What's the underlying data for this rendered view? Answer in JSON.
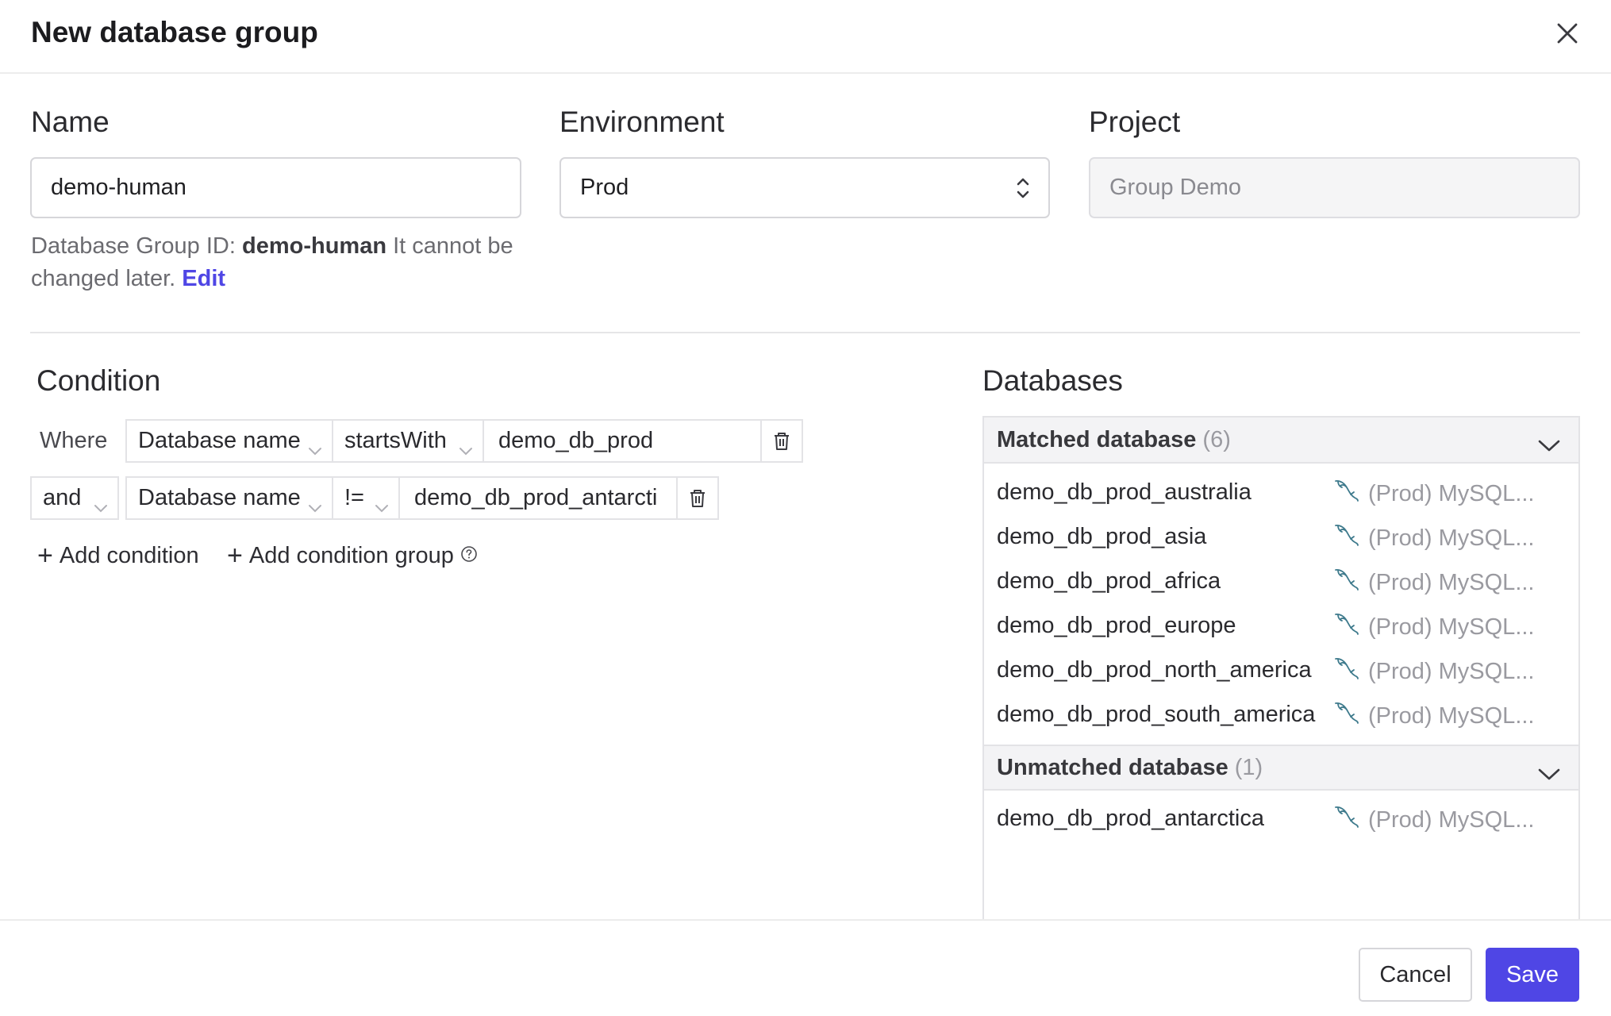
{
  "dialog": {
    "title": "New database group",
    "close_icon": "close-icon"
  },
  "form": {
    "name_label": "Name",
    "name_value": "demo-human",
    "environment_label": "Environment",
    "environment_value": "Prod",
    "project_label": "Project",
    "project_value": "Group Demo",
    "hint_prefix": "Database Group ID:",
    "hint_id": "demo-human",
    "hint_suffix": "It cannot be changed later.",
    "hint_edit": "Edit"
  },
  "condition": {
    "title": "Condition",
    "rows": [
      {
        "conjunction": "Where",
        "field": "Database name",
        "operator": "startsWith",
        "value": "demo_db_prod"
      },
      {
        "conjunction": "and",
        "field": "Database name",
        "operator": "!=",
        "value": "demo_db_prod_antarcti"
      }
    ],
    "add_condition": "Add condition",
    "add_condition_group": "Add condition group"
  },
  "databases": {
    "title": "Databases",
    "matched": {
      "label": "Matched database",
      "count": "(6)",
      "items": [
        {
          "name": "demo_db_prod_australia",
          "instance": "(Prod) MySQL..."
        },
        {
          "name": "demo_db_prod_asia",
          "instance": "(Prod) MySQL..."
        },
        {
          "name": "demo_db_prod_africa",
          "instance": "(Prod) MySQL..."
        },
        {
          "name": "demo_db_prod_europe",
          "instance": "(Prod) MySQL..."
        },
        {
          "name": "demo_db_prod_north_america",
          "instance": "(Prod) MySQL..."
        },
        {
          "name": "demo_db_prod_south_america",
          "instance": "(Prod) MySQL..."
        }
      ]
    },
    "unmatched": {
      "label": "Unmatched database",
      "count": "(1)",
      "items": [
        {
          "name": "demo_db_prod_antarctica",
          "instance": "(Prod) MySQL..."
        }
      ]
    }
  },
  "footer": {
    "cancel_label": "Cancel",
    "save_label": "Save"
  },
  "colors": {
    "accent": "#4f46e5",
    "mysql_icon": "#3e7a8c"
  }
}
